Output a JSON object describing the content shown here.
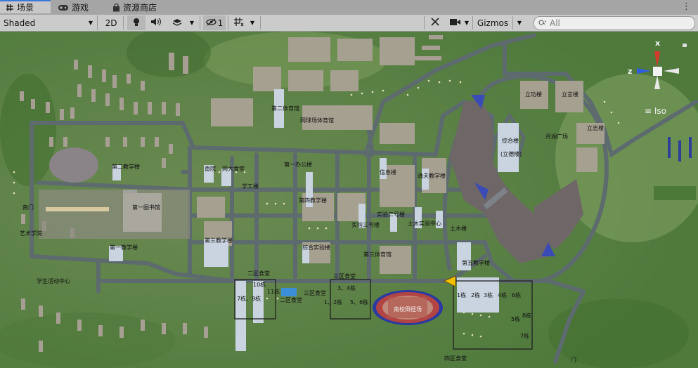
{
  "tabs": [
    {
      "label": "场景",
      "icon": "grid-icon"
    },
    {
      "label": "游戏",
      "icon": "gamepad-icon"
    },
    {
      "label": "资源商店",
      "icon": "shopping-bag-icon"
    }
  ],
  "toolbar": {
    "shading_mode": "Shaded",
    "mode_2d": "2D",
    "hidden_count": "1",
    "gizmos_label": "Gizmos",
    "search_placeholder": "All"
  },
  "gizmo": {
    "x_label": "x",
    "z_label": "z",
    "projection": "Iso"
  },
  "map_labels": {
    "gym2": "第二体育馆",
    "court_gym": "网球场体育馆",
    "teach_building1": "第二教学楼",
    "office1": "第一办公楼",
    "info_bldg": "信息楼",
    "yifu_bldg": "逸夫教学楼",
    "teach4": "第四教学楼",
    "library": "南院",
    "wenda": "网大食堂",
    "xuegong": "学工楼",
    "south_gate": "南门",
    "first_lab": "第一图书馆",
    "teach_main1": "第一教学楼",
    "teach3": "第三教学楼",
    "art_bldg": "艺术学院",
    "student_center": "学生活动中心",
    "experiment2": "综合实验楼",
    "canteen2": "二区食堂",
    "canteen3": "三区食堂",
    "bldg_num10": "10栋",
    "bldg_num11": "11栋",
    "bldg_num7_9": "7栋、9栋",
    "canteen2_name": "二区食堂",
    "canteen3_name": "三区食堂",
    "z3_4": "3、4栋",
    "z1_2": "1、2栋",
    "z5_6": "5、6栋",
    "track": "南校田径场",
    "third_gym": "第三体育馆",
    "shiyan2": "实验二号楼",
    "shiyan3": "实验三号楼",
    "tumu_center": "土木实验中心",
    "tumu_bldg": "土木楼",
    "teach5": "第五教学楼",
    "dorm_1": "1栋",
    "dorm_2": "2栋",
    "dorm_3": "3栋",
    "dorm_4": "4栋",
    "dorm_6": "6栋",
    "dorm_5": "5栋",
    "dorm_8": "8栋",
    "dorm_7": "7栋",
    "lizhi": "立功楼",
    "lixin": "立言楼",
    "zonghe_a": "综合楼",
    "zonghe_b": "(立德楼)",
    "yuehu": "月湖广场",
    "lide_plaza": "立志楼",
    "fourth_canteen": "四区食堂",
    "gate": "门"
  }
}
